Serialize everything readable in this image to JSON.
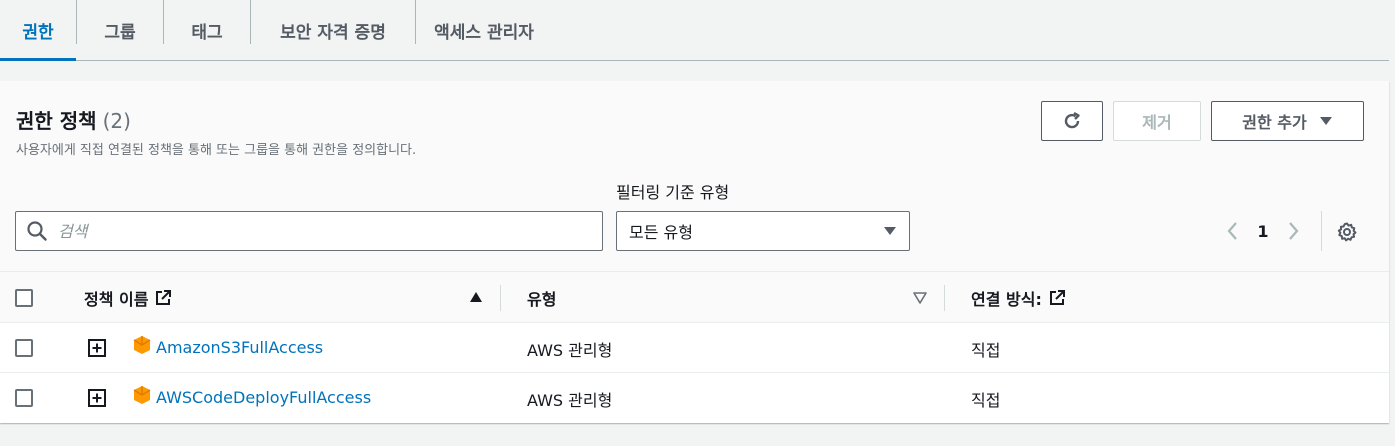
{
  "tabs": [
    {
      "label": "권한",
      "active": true
    },
    {
      "label": "그룹",
      "active": false
    },
    {
      "label": "태그",
      "active": false
    },
    {
      "label": "보안 자격 증명",
      "active": false
    },
    {
      "label": "액세스 관리자",
      "active": false
    }
  ],
  "panel": {
    "title": "권한 정책",
    "count": "(2)",
    "description": "사용자에게 직접 연결된 정책을 통해 또는 그룹을 통해 권한을 정의합니다.",
    "buttons": {
      "refresh_icon": "refresh-icon",
      "remove": "제거",
      "add": "권한 추가"
    },
    "filter_label": "필터링 기준 유형",
    "search_placeholder": "검색",
    "select_value": "모든 유형",
    "page": "1"
  },
  "table": {
    "columns": [
      "정책 이름",
      "유형",
      "연결 방식:"
    ],
    "rows": [
      {
        "name": "AmazonS3FullAccess",
        "type": "AWS 관리형",
        "attached": "직접"
      },
      {
        "name": "AWSCodeDeployFullAccess",
        "type": "AWS 관리형",
        "attached": "직접"
      }
    ]
  },
  "colors": {
    "accent": "#0073bb",
    "policy_icon": "#ff9900",
    "border": "#687078"
  }
}
